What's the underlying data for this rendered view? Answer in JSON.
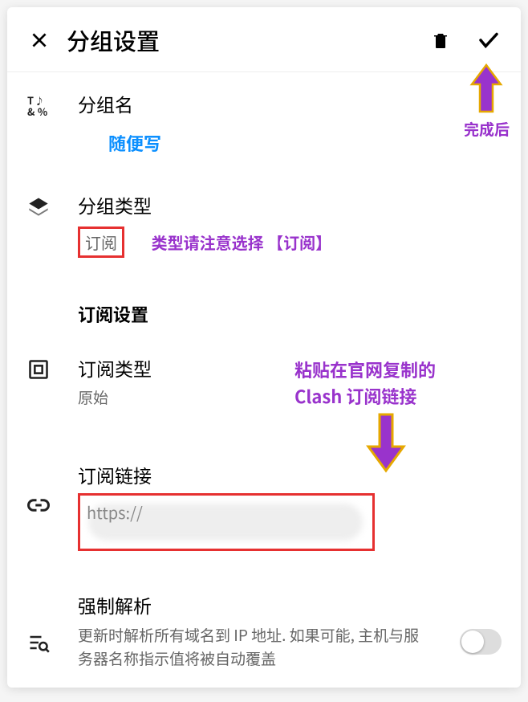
{
  "header": {
    "title": "分组设置"
  },
  "groupName": {
    "label": "分组名",
    "value": "随便写"
  },
  "groupType": {
    "label": "分组类型",
    "value": "订阅",
    "annotation": "类型请注意选择 【订阅】"
  },
  "subSection": {
    "title": "订阅设置"
  },
  "subType": {
    "label": "订阅类型",
    "value": "原始"
  },
  "subUrl": {
    "label": "订阅链接",
    "value": "https://",
    "annotation_line1": "粘贴在官网复制的",
    "annotation_line2": "Clash 订阅链接"
  },
  "forceResolve": {
    "label": "强制解析",
    "desc": "更新时解析所有域名到 IP 地址. 如果可能, 主机与服务器名称指示值将被自动覆盖"
  },
  "annotations": {
    "afterComplete": "完成后"
  }
}
